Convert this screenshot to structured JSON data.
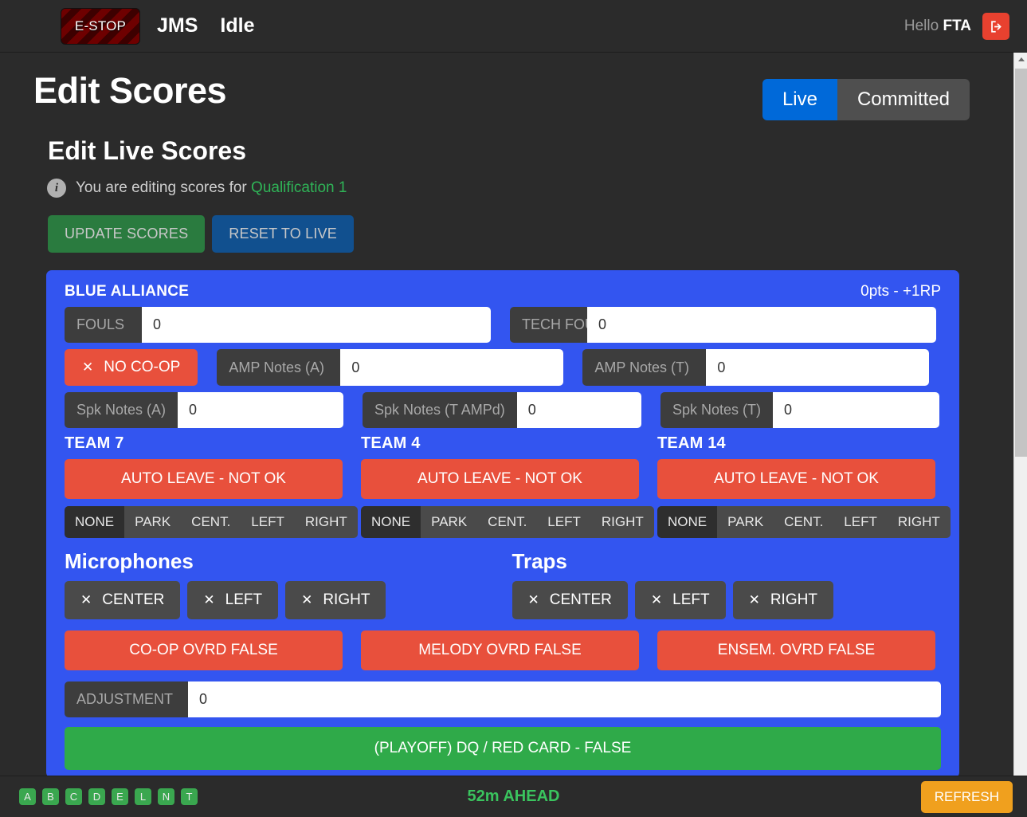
{
  "topnav": {
    "estop_label": "E-STOP",
    "app_title": "JMS",
    "match_state": "Idle",
    "hello_prefix": "Hello ",
    "hello_user": "FTA",
    "logout_icon": "logout-icon"
  },
  "page": {
    "title": "Edit Scores",
    "section_title": "Edit Live Scores",
    "editing_prefix": "You are editing scores for ",
    "editing_match": "Qualification 1",
    "info_icon": "info-icon"
  },
  "mode_toggle": {
    "live_label": "Live",
    "committed_label": "Committed",
    "active": "Live"
  },
  "actions": {
    "update_label": "UPDATE SCORES",
    "reset_label": "RESET TO LIVE"
  },
  "alliance": {
    "name": "BLUE ALLIANCE",
    "score_summary": "0pts - +1RP",
    "fouls": {
      "label": "FOULS",
      "value": "0"
    },
    "tech_fouls": {
      "label": "TECH FOULS",
      "value": "0"
    },
    "coop": {
      "label": "NO CO-OP",
      "icon": "x-icon"
    },
    "amp_notes_a": {
      "label": "AMP Notes (A)",
      "value": "0"
    },
    "amp_notes_t": {
      "label": "AMP Notes (T)",
      "value": "0"
    },
    "spk_notes_a": {
      "label": "Spk Notes (A)",
      "value": "0"
    },
    "spk_notes_t_ampd": {
      "label": "Spk Notes (T AMPd)",
      "value": "0"
    },
    "spk_notes_t": {
      "label": "Spk Notes (T)",
      "value": "0"
    },
    "teams": [
      {
        "name": "TEAM 7",
        "auto_leave": "AUTO LEAVE - NOT OK",
        "segments": [
          "NONE",
          "PARK",
          "CENT.",
          "LEFT",
          "RIGHT"
        ],
        "selected_segment": "NONE"
      },
      {
        "name": "TEAM 4",
        "auto_leave": "AUTO LEAVE - NOT OK",
        "segments": [
          "NONE",
          "PARK",
          "CENT.",
          "LEFT",
          "RIGHT"
        ],
        "selected_segment": "NONE"
      },
      {
        "name": "TEAM 14",
        "auto_leave": "AUTO LEAVE - NOT OK",
        "segments": [
          "NONE",
          "PARK",
          "CENT.",
          "LEFT",
          "RIGHT"
        ],
        "selected_segment": "NONE"
      }
    ],
    "microphones": {
      "title": "Microphones",
      "options": [
        "CENTER",
        "LEFT",
        "RIGHT"
      ]
    },
    "traps": {
      "title": "Traps",
      "options": [
        "CENTER",
        "LEFT",
        "RIGHT"
      ]
    },
    "overrides": [
      "CO-OP OVRD FALSE",
      "MELODY OVRD FALSE",
      "ENSEM. OVRD FALSE"
    ],
    "adjustment": {
      "label": "ADJUSTMENT",
      "value": "0"
    },
    "dq_label": "(PLAYOFF) DQ / RED CARD - FALSE"
  },
  "bottombar": {
    "letters": [
      "A",
      "B",
      "C",
      "D",
      "E",
      "L",
      "N",
      "T"
    ],
    "schedule_status": "52m AHEAD",
    "refresh_label": "REFRESH"
  },
  "colors": {
    "alliance_blue": "#3355f0",
    "danger_red": "#e8503c",
    "success_green": "#2faa49",
    "accent_orange": "#f0a01e",
    "link_green": "#2fb457",
    "primary_blue": "#0069d9"
  }
}
